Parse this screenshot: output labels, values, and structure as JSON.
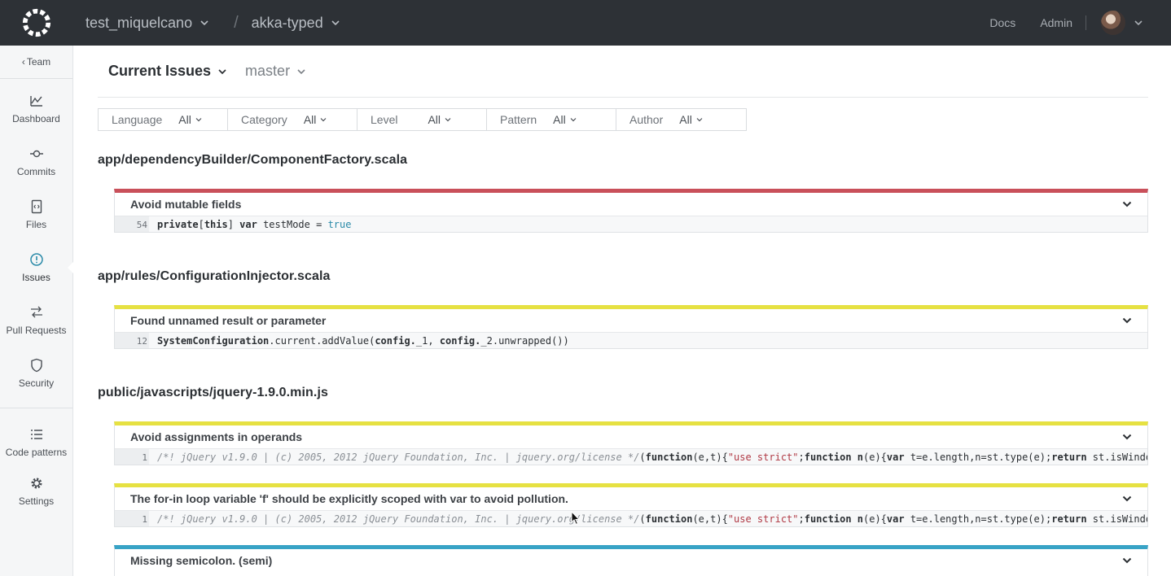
{
  "topbar": {
    "org": "test_miquelcano",
    "separator": "/",
    "repo": "akka-typed",
    "docs": "Docs",
    "admin": "Admin"
  },
  "sidebar": {
    "back": "Team",
    "items": [
      {
        "label": "Dashboard",
        "icon": "dashboard-icon"
      },
      {
        "label": "Commits",
        "icon": "commit-icon"
      },
      {
        "label": "Files",
        "icon": "file-icon"
      },
      {
        "label": "Issues",
        "icon": "issue-icon"
      },
      {
        "label": "Pull Requests",
        "icon": "pull-request-icon"
      },
      {
        "label": "Security",
        "icon": "shield-icon"
      }
    ],
    "bottom": [
      {
        "label": "Code patterns",
        "icon": "list-icon"
      },
      {
        "label": "Settings",
        "icon": "gear-icon"
      }
    ]
  },
  "header": {
    "title": "Current Issues",
    "branch": "master"
  },
  "filters": [
    {
      "label": "Language",
      "value": "All"
    },
    {
      "label": "Category",
      "value": "All"
    },
    {
      "label": "Level",
      "value": "All"
    },
    {
      "label": "Pattern",
      "value": "All"
    },
    {
      "label": "Author",
      "value": "All"
    }
  ],
  "files": [
    {
      "path": "app/dependencyBuilder/ComponentFactory.scala"
    },
    {
      "path": "app/rules/ConfigurationInjector.scala"
    },
    {
      "path": "public/javascripts/jquery-1.9.0.min.js"
    }
  ],
  "issues": [
    {
      "title": "Avoid mutable fields",
      "line": "54",
      "code": {
        "k1": "private",
        "p1": "[",
        "k2": "this",
        "p2": "] ",
        "k3": "var",
        "p3": " testMode = ",
        "lit": "true"
      }
    },
    {
      "title": "Found unnamed result or parameter",
      "line": "12",
      "code": {
        "k1": "SystemConfiguration",
        "p1": ".current.addValue(",
        "k2": "config.",
        "p2": "_1, ",
        "k3": "config.",
        "p3": "_2.unwrapped())"
      }
    },
    {
      "title": "Avoid assignments in operands",
      "line": "1",
      "code": {
        "cmt": "/*! jQuery v1.9.0 | (c) 2005, 2012 jQuery Foundation, Inc. | jquery.org/license */",
        "p1": "(",
        "k1": "function",
        "p2": "(e,t){",
        "str": "\"use strict\"",
        "p3": ";",
        "k2": "function",
        "n": " n",
        "p4": "(e){",
        "k3": "var",
        "p5": " t=e.length,n=st.type(e);",
        "k4": "return",
        "p6": " st.isWindow"
      }
    },
    {
      "title": "The for-in loop variable 'f' should be explicitly scoped with var to avoid pollution.",
      "line": "1",
      "code": {
        "cmt": "/*! jQuery v1.9.0 | (c) 2005, 2012 jQuery Foundation, Inc. | jquery.org/license */",
        "p1": "(",
        "k1": "function",
        "p2": "(e,t){",
        "str": "\"use strict\"",
        "p3": ";",
        "k2": "function",
        "n": " n",
        "p4": "(e){",
        "k3": "var",
        "p5": " t=e.length,n=st.type(e);",
        "k4": "return",
        "p6": " st.isWindow"
      }
    },
    {
      "title": "Missing semicolon. (semi)"
    }
  ],
  "colors": {
    "topbar": "#2d3136",
    "severity_error": "#c9505a",
    "severity_warning": "#e6e142",
    "severity_info": "#38a3c6"
  }
}
